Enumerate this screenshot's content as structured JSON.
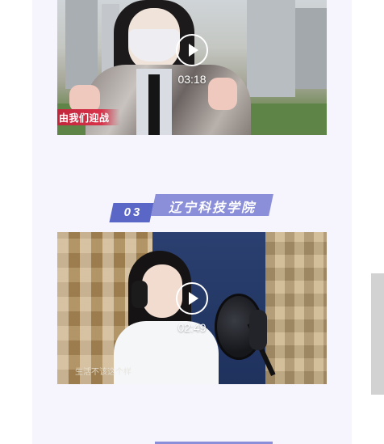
{
  "videos": [
    {
      "duration": "03:18",
      "caption": "由我们迎战",
      "play_icon": "play-icon"
    },
    {
      "duration": "02:49",
      "caption": "生活不该这个样",
      "play_icon": "play-icon"
    }
  ],
  "section": {
    "number": "03",
    "school_name": "辽宁科技学院"
  },
  "colors": {
    "page_background": "#f6f4fc",
    "number_badge": "#5b67c6",
    "name_badge": "#8b8ed8",
    "scrollbar": "#d2d2d2"
  }
}
